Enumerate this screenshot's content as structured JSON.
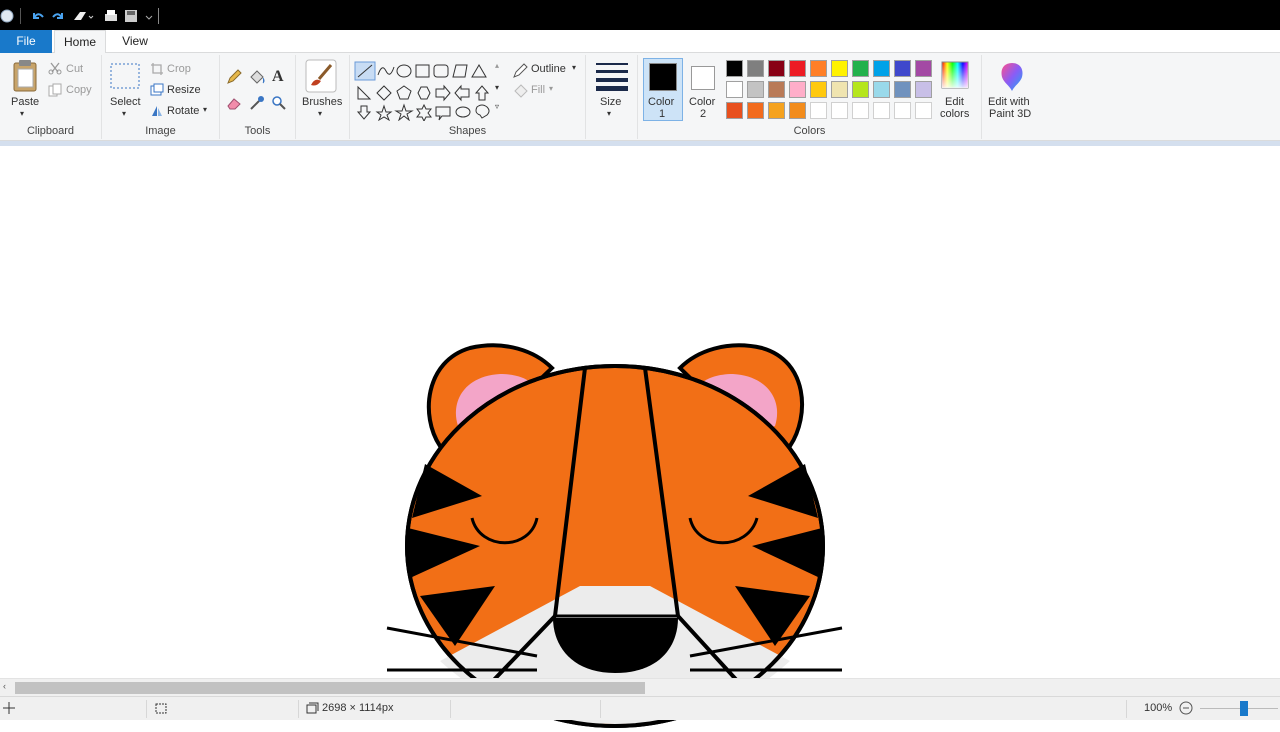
{
  "tabs": {
    "file": "File",
    "home": "Home",
    "view": "View"
  },
  "clipboard": {
    "paste": "Paste",
    "cut": "Cut",
    "copy": "Copy",
    "group": "Clipboard"
  },
  "image": {
    "select": "Select",
    "crop": "Crop",
    "resize": "Resize",
    "rotate": "Rotate",
    "group": "Image"
  },
  "tools": {
    "group": "Tools"
  },
  "brushes": {
    "label": "Brushes"
  },
  "shapes": {
    "outline": "Outline",
    "fill": "Fill",
    "group": "Shapes"
  },
  "size": {
    "label": "Size"
  },
  "colors": {
    "color1": "Color",
    "color1_num": "1",
    "color2": "Color",
    "color2_num": "2",
    "edit_line1": "Edit",
    "edit_line2": "colors",
    "group": "Colors",
    "color1_value": "#000000",
    "color2_value": "#ffffff",
    "palette_row1": [
      "#000000",
      "#7f7f7f",
      "#880015",
      "#ed1c24",
      "#ff7f27",
      "#fff200",
      "#22b14c",
      "#00a2e8",
      "#3f48cc",
      "#a349a4"
    ],
    "palette_row2": [
      "#ffffff",
      "#c3c3c3",
      "#b97a57",
      "#ffaec9",
      "#ffc90e",
      "#efe4b0",
      "#b5e61d",
      "#99d9ea",
      "#7092be",
      "#c8bfe7"
    ],
    "palette_row3": [
      "#e8501e",
      "#f26b1d",
      "#f5a21e",
      "#f28c1c",
      "#ffffff",
      "#ffffff",
      "#ffffff",
      "#ffffff",
      "#ffffff",
      "#ffffff"
    ]
  },
  "paint3d": {
    "line1": "Edit with",
    "line2": "Paint 3D"
  },
  "status": {
    "dimensions": "2698 × 1114px",
    "zoom": "100%"
  }
}
